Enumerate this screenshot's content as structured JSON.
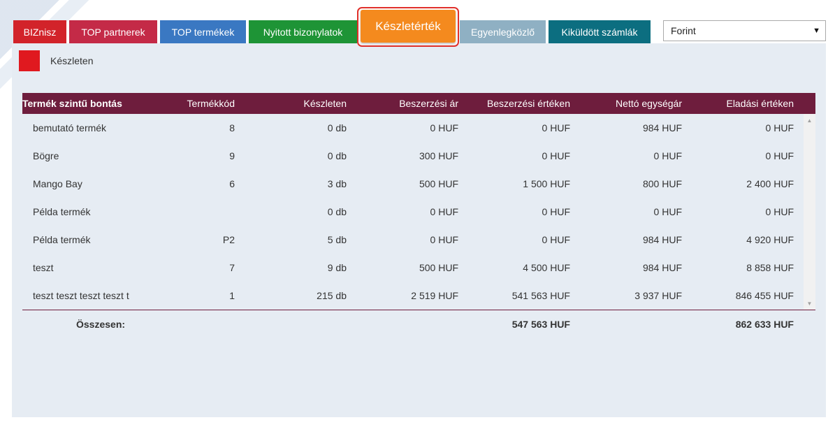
{
  "tabs": [
    {
      "label": "BIZnisz",
      "color": "#d2232a"
    },
    {
      "label": "TOP partnerek",
      "color": "#c42a47"
    },
    {
      "label": "TOP termékek",
      "color": "#3a78c2"
    },
    {
      "label": "Nyitott bizonylatok",
      "color": "#1e9436"
    },
    {
      "label": "Készletérték",
      "color": "#f48a1e",
      "active": true
    },
    {
      "label": "Egyenlegközlő",
      "color": "#8fb0c3"
    },
    {
      "label": "Kiküldött számlák",
      "color": "#0c6e80"
    }
  ],
  "currency": {
    "selected": "Forint"
  },
  "legend": {
    "label": "Készleten",
    "color": "#e0191f"
  },
  "table": {
    "headers": [
      "Termék szintű bontás",
      "Termékkód",
      "Készleten",
      "Beszerzési ár",
      "Beszerzési értéken",
      "Nettó egységár",
      "Eladási értéken"
    ],
    "rows": [
      [
        "bemutató termék",
        "8",
        "0 db",
        "0 HUF",
        "0 HUF",
        "984 HUF",
        "0 HUF"
      ],
      [
        "Bögre",
        "9",
        "0 db",
        "300 HUF",
        "0 HUF",
        "0 HUF",
        "0 HUF"
      ],
      [
        "Mango Bay",
        "6",
        "3 db",
        "500 HUF",
        "1 500 HUF",
        "800 HUF",
        "2 400 HUF"
      ],
      [
        "Példa termék",
        "",
        "0 db",
        "0 HUF",
        "0 HUF",
        "0 HUF",
        "0 HUF"
      ],
      [
        "Példa termék",
        "P2",
        "5 db",
        "0 HUF",
        "0 HUF",
        "984 HUF",
        "4 920 HUF"
      ],
      [
        "teszt",
        "7",
        "9 db",
        "500 HUF",
        "4 500 HUF",
        "984 HUF",
        "8 858 HUF"
      ],
      [
        "teszt teszt teszt teszt t",
        "1",
        "215 db",
        "2 519 HUF",
        "541 563 HUF",
        "3 937 HUF",
        "846 455 HUF"
      ]
    ],
    "total_label": "Összesen:",
    "total_purchase_value": "547 563 HUF",
    "total_sales_value": "862 633 HUF"
  }
}
